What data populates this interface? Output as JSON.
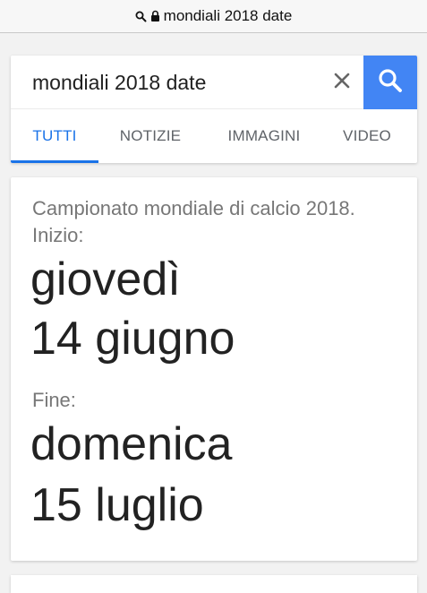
{
  "address_bar": {
    "url_text": "mondiali 2018 date",
    "icons": [
      "search-icon",
      "lock-icon"
    ]
  },
  "search": {
    "query": "mondiali 2018 date",
    "clear_icon": "close-icon",
    "search_icon": "search-icon",
    "accent_color": "#4285f4"
  },
  "tabs": [
    {
      "label": "TUTTI",
      "active": true
    },
    {
      "label": "NOTIZIE",
      "active": false
    },
    {
      "label": "IMMAGINI",
      "active": false
    },
    {
      "label": "VIDEO",
      "active": false
    }
  ],
  "answer": {
    "subtitle": "Campionato mondiale di calcio 2018. Inizio:",
    "start_day": "giovedì",
    "start_date": "14 giugno",
    "end_label": "Fine:",
    "end_day": "domenica",
    "end_date": "15 luglio"
  }
}
